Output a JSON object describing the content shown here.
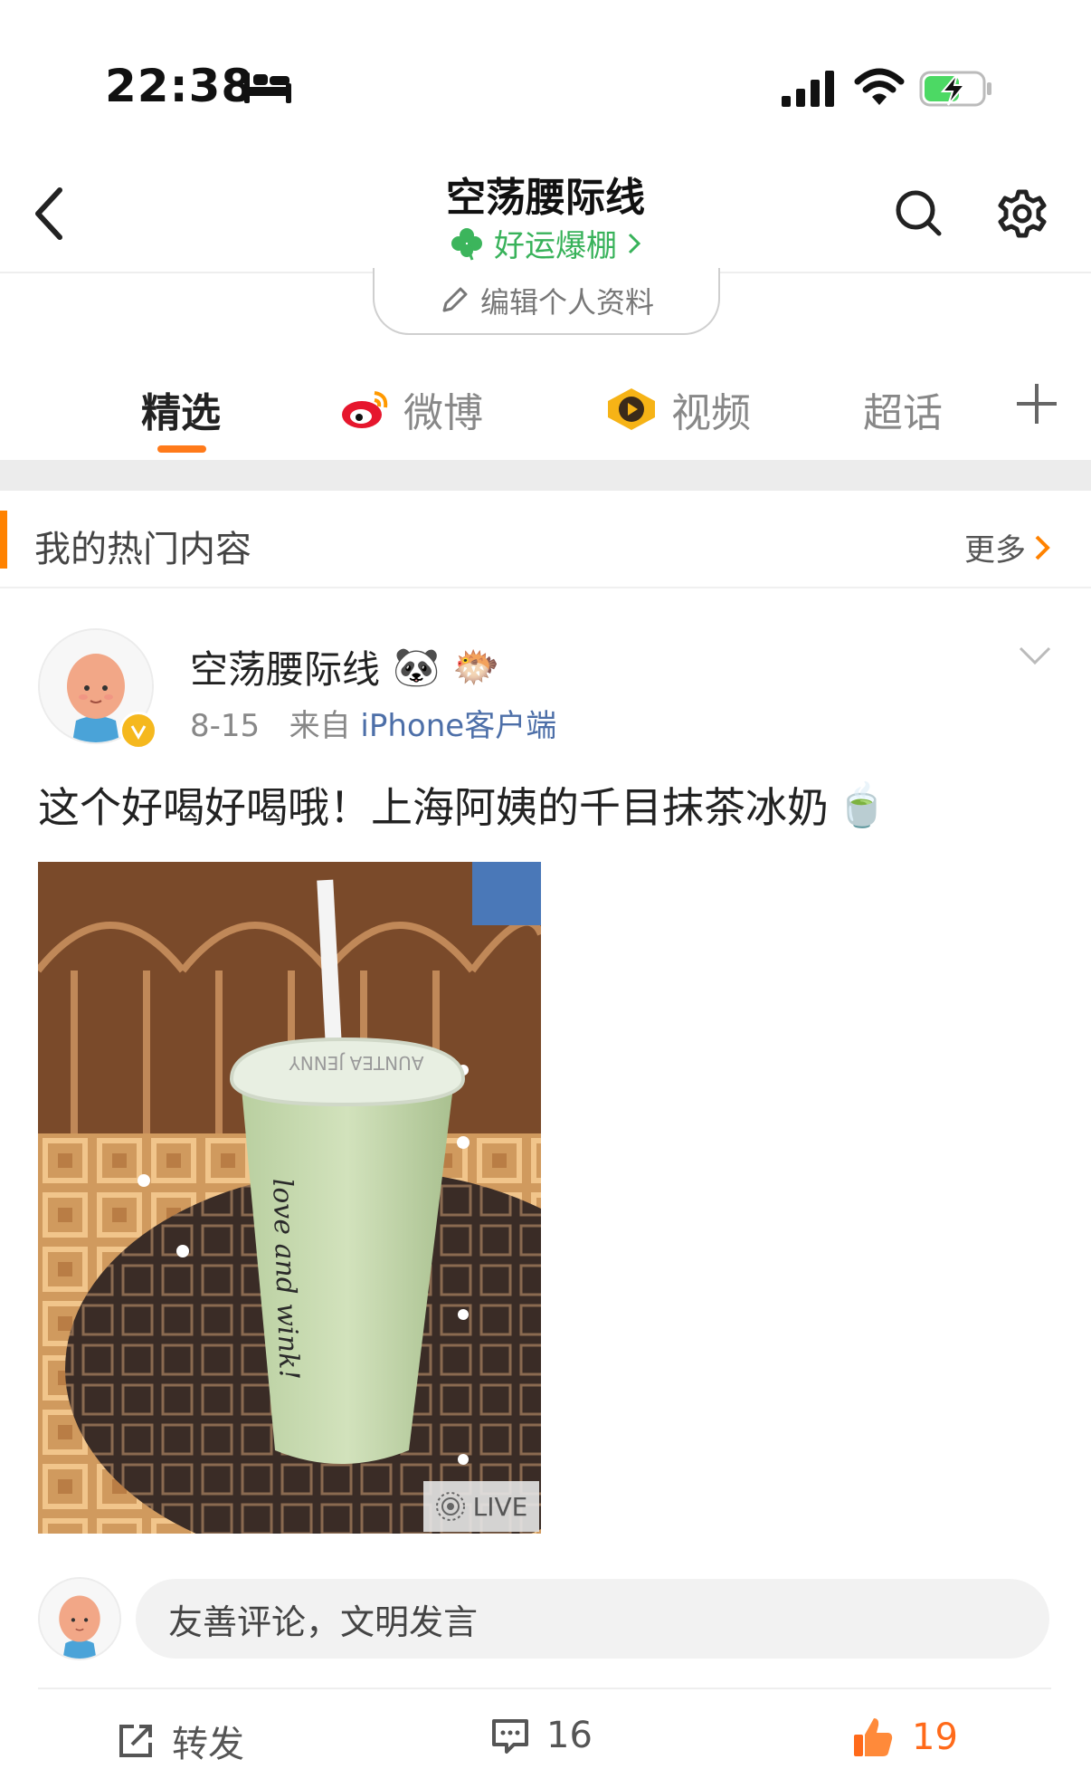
{
  "status_bar": {
    "time": "22:38",
    "bed_icon": "bed-icon",
    "signal_icon": "signal-icon",
    "wifi_icon": "wifi-icon",
    "battery_icon": "battery-charging-icon"
  },
  "header": {
    "title": "空荡腰际线",
    "lucky_label": "好运爆棚",
    "edit_profile": "编辑个人资料",
    "icons": [
      "back-icon",
      "search-icon",
      "gear-icon",
      "clover-icon",
      "pencil-icon"
    ]
  },
  "tabs": [
    {
      "label": "精选",
      "active": true
    },
    {
      "label": "微博",
      "icon": "weibo-icon"
    },
    {
      "label": "视频",
      "icon": "video-icon"
    },
    {
      "label": "超话"
    }
  ],
  "section": {
    "title": "我的热门内容",
    "more": "更多"
  },
  "post": {
    "author": "空荡腰际线",
    "author_emojis": [
      "🐼",
      "🐡"
    ],
    "date": "8-15",
    "source_prefix": "来自",
    "source": "iPhone客户端",
    "text": "这个好喝好喝哦！上海阿姨的千目抹茶冰奶",
    "text_emoji": "🍵",
    "image_cup_text": "love and wink!",
    "image_lid_text": "AUNTEA JENNY",
    "live_label": "LIVE"
  },
  "comment": {
    "placeholder": "友善评论，文明发言"
  },
  "actions": {
    "repost": "转发",
    "comments": "16",
    "likes": "19"
  },
  "colors": {
    "accent": "#ff8200",
    "lucky_green": "#38b25a",
    "source_blue": "#4d6fa8"
  }
}
